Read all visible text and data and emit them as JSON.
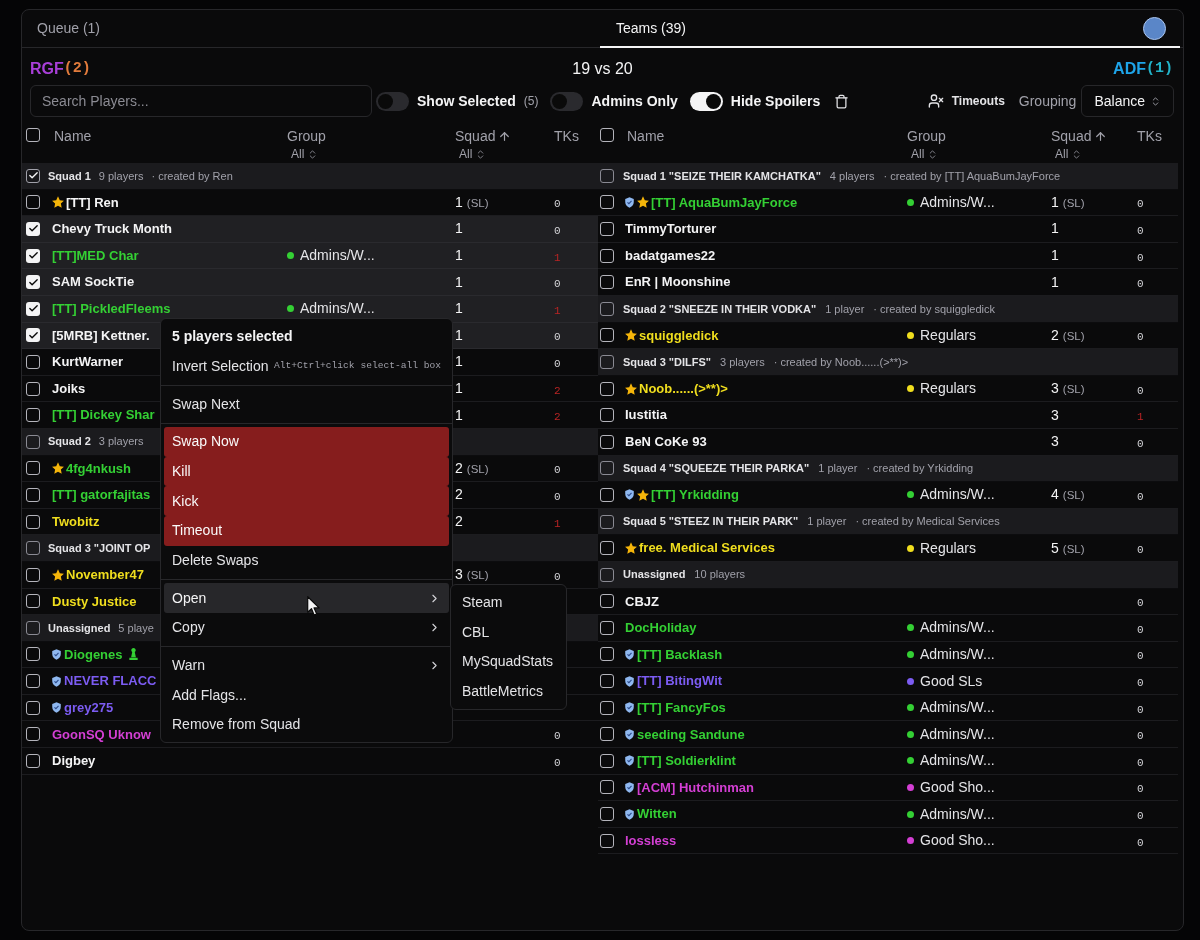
{
  "tabs": [
    {
      "label": "Queue (1)",
      "selected": false
    },
    {
      "label": "Teams (39)",
      "selected": true
    }
  ],
  "match": {
    "teams": [
      {
        "name": "RGF",
        "color": "#a83fd8",
        "count": {
          "label": "(2)",
          "color": "#e27b3c"
        }
      },
      {
        "name": "ADF",
        "color": "#1ea5ea",
        "count": {
          "label": "(1)",
          "color": "#22b3c9"
        }
      }
    ],
    "score": "19 vs 20"
  },
  "toolbar": {
    "search": {
      "placeholder": "Search Players..."
    },
    "toggles": [
      {
        "label": "Show Selected",
        "count": "(5)",
        "on": false
      },
      {
        "label": "Admins Only",
        "on": false
      },
      {
        "label": "Hide Spoilers",
        "on": true
      }
    ],
    "timeouts": "Timeouts",
    "grouping": {
      "label": "Grouping",
      "value": "Balance"
    }
  },
  "tables": [
    {
      "select_all": false,
      "columns": [
        {
          "label": "Name",
          "sorted": false
        },
        {
          "label": "Group",
          "filter": "All",
          "sorted": false
        },
        {
          "label": "Squad",
          "filter": "All",
          "sorted": true
        },
        {
          "label": "TKs",
          "sorted": false
        }
      ],
      "rows": [
        {
          "kind": "squad",
          "checked": true,
          "title": "Squad 1",
          "players": "9 players",
          "creator": "· created by Ren"
        },
        {
          "kind": "player",
          "checked": false,
          "name": "[TT] Ren",
          "color": "#f4f4f5",
          "shield": false,
          "star": true,
          "pawn": false,
          "squad": "1",
          "sl": "(SL)",
          "tks": "0",
          "tks_alert": false
        },
        {
          "kind": "player",
          "checked": true,
          "name": "Chevy Truck Month",
          "color": "#f4f4f5",
          "shield": false,
          "star": false,
          "pawn": false,
          "squad": "1",
          "tks": "0",
          "tks_alert": false
        },
        {
          "kind": "player",
          "checked": true,
          "name": "[TT]MED Char",
          "color": "#34d034",
          "shield": false,
          "star": false,
          "pawn": false,
          "group": {
            "label": "Admins/W...",
            "color": "#34d034"
          },
          "squad": "1",
          "tks": "1",
          "tks_alert": true
        },
        {
          "kind": "player",
          "checked": true,
          "name": "SAM SockTie",
          "color": "#f4f4f5",
          "shield": false,
          "star": false,
          "pawn": false,
          "squad": "1",
          "tks": "0",
          "tks_alert": false
        },
        {
          "kind": "player",
          "checked": true,
          "name": "[TT] PickledFleems",
          "color": "#34d034",
          "shield": false,
          "star": false,
          "pawn": false,
          "group": {
            "label": "Admins/W...",
            "color": "#34d034"
          },
          "squad": "1",
          "tks": "1",
          "tks_alert": true
        },
        {
          "kind": "player",
          "checked": true,
          "name": "[5MRB] Kettner.",
          "color": "#f4f4f5",
          "shield": false,
          "star": false,
          "pawn": false,
          "squad": "1",
          "tks": "0",
          "tks_alert": false
        },
        {
          "kind": "player",
          "checked": false,
          "name": "KurtWarner",
          "color": "#f4f4f5",
          "shield": false,
          "star": false,
          "pawn": false,
          "squad": "1",
          "tks": "0",
          "tks_alert": false
        },
        {
          "kind": "player",
          "checked": false,
          "name": "Joiks",
          "color": "#f4f4f5",
          "shield": false,
          "star": false,
          "pawn": false,
          "squad": "1",
          "tks": "2",
          "tks_alert": true
        },
        {
          "kind": "player",
          "checked": false,
          "name": "[TT] Dickey Shar",
          "color": "#34d034",
          "shield": false,
          "star": false,
          "pawn": false,
          "squad": "1",
          "tks": "2",
          "tks_alert": true
        },
        {
          "kind": "squad",
          "checked": false,
          "title": "Squad 2",
          "players": "3 players"
        },
        {
          "kind": "player",
          "checked": false,
          "name": "4fg4nkush",
          "color": "#34d034",
          "shield": false,
          "star": true,
          "pawn": false,
          "squad": "2",
          "sl": "(SL)",
          "tks": "0",
          "tks_alert": false
        },
        {
          "kind": "player",
          "checked": false,
          "name": "[TT] gatorfajitas",
          "color": "#34d034",
          "shield": false,
          "star": false,
          "pawn": false,
          "squad": "2",
          "tks": "0",
          "tks_alert": false
        },
        {
          "kind": "player",
          "checked": false,
          "name": "Twobitz",
          "color": "#f0de1e",
          "shield": false,
          "star": false,
          "pawn": false,
          "squad": "2",
          "tks": "1",
          "tks_alert": true
        },
        {
          "kind": "squad",
          "checked": false,
          "title": "Squad 3 \"JOINT OP"
        },
        {
          "kind": "player",
          "checked": false,
          "name": "November47",
          "color": "#f0de1e",
          "shield": false,
          "star": true,
          "pawn": false,
          "squad": "3",
          "sl": "(SL)",
          "tks": "0",
          "tks_alert": false
        },
        {
          "kind": "player",
          "checked": false,
          "name": "Dusty Justice",
          "color": "#f0de1e",
          "shield": false,
          "star": false,
          "pawn": false
        },
        {
          "kind": "squad",
          "checked": false,
          "title": "Unassigned",
          "players": "5 playe"
        },
        {
          "kind": "player",
          "checked": false,
          "name": "Diogenes",
          "color": "#34d034",
          "shield": true,
          "star": false,
          "pawn": true
        },
        {
          "kind": "player",
          "checked": false,
          "name": "NEVER FLACC",
          "color": "#7c5cf2",
          "shield": true,
          "star": false,
          "pawn": false
        },
        {
          "kind": "player",
          "checked": false,
          "name": "grey275",
          "color": "#7c5cf2",
          "shield": true,
          "star": false,
          "pawn": false
        },
        {
          "kind": "player",
          "checked": false,
          "name": "GoonSQ Uknow",
          "color": "#d43fd4",
          "shield": false,
          "star": false,
          "pawn": false,
          "tks": "0",
          "tks_alert": false
        },
        {
          "kind": "player",
          "checked": false,
          "name": "Digbey",
          "color": "#f4f4f5",
          "shield": false,
          "star": false,
          "pawn": false,
          "tks": "0",
          "tks_alert": false
        }
      ]
    },
    {
      "select_all": false,
      "columns": [
        {
          "label": "Name",
          "sorted": false
        },
        {
          "label": "Group",
          "filter": "All",
          "sorted": false
        },
        {
          "label": "Squad",
          "filter": "All",
          "sorted": true
        },
        {
          "label": "TKs",
          "sorted": false
        }
      ],
      "rows": [
        {
          "kind": "squad",
          "checked": false,
          "title": "Squad 1 \"SEIZE THEIR KAMCHATKA\"",
          "players": "4 players",
          "creator": "· created by [TT] AquaBumJayForce"
        },
        {
          "kind": "player",
          "checked": false,
          "name": "[TT] AquaBumJayForce",
          "color": "#34d034",
          "shield": true,
          "star": true,
          "pawn": false,
          "group": {
            "label": "Admins/W...",
            "color": "#34d034"
          },
          "squad": "1",
          "sl": "(SL)",
          "tks": "0",
          "tks_alert": false
        },
        {
          "kind": "player",
          "checked": false,
          "name": "TimmyTorturer",
          "color": "#f4f4f5",
          "shield": false,
          "star": false,
          "pawn": false,
          "squad": "1",
          "tks": "0",
          "tks_alert": false
        },
        {
          "kind": "player",
          "checked": false,
          "name": "badatgames22",
          "color": "#f4f4f5",
          "shield": false,
          "star": false,
          "pawn": false,
          "squad": "1",
          "tks": "0",
          "tks_alert": false
        },
        {
          "kind": "player",
          "checked": false,
          "name": "EnR | Moonshine",
          "color": "#f4f4f5",
          "shield": false,
          "star": false,
          "pawn": false,
          "squad": "1",
          "tks": "0",
          "tks_alert": false
        },
        {
          "kind": "squad",
          "checked": false,
          "title": "Squad 2 \"SNEEZE IN THEIR VODKA\"",
          "players": "1 player",
          "creator": "· created by squiggledick"
        },
        {
          "kind": "player",
          "checked": false,
          "name": "squiggledick",
          "color": "#f0de1e",
          "shield": false,
          "star": true,
          "pawn": false,
          "group": {
            "label": "Regulars",
            "color": "#f0de1e"
          },
          "squad": "2",
          "sl": "(SL)",
          "tks": "0",
          "tks_alert": false
        },
        {
          "kind": "squad",
          "checked": false,
          "title": "Squad 3 \"DILFS\"",
          "players": "3 players",
          "creator": "· created by Noob......(>**)>"
        },
        {
          "kind": "player",
          "checked": false,
          "name": "Noob......(>**)>",
          "color": "#f0de1e",
          "shield": false,
          "star": true,
          "pawn": false,
          "group": {
            "label": "Regulars",
            "color": "#f0de1e"
          },
          "squad": "3",
          "sl": "(SL)",
          "tks": "0",
          "tks_alert": false
        },
        {
          "kind": "player",
          "checked": false,
          "name": "Iustitia",
          "color": "#f4f4f5",
          "shield": false,
          "star": false,
          "pawn": false,
          "squad": "3",
          "tks": "1",
          "tks_alert": true
        },
        {
          "kind": "player",
          "checked": false,
          "name": "BeN CoKe 93",
          "color": "#f4f4f5",
          "shield": false,
          "star": false,
          "pawn": false,
          "squad": "3",
          "tks": "0",
          "tks_alert": false
        },
        {
          "kind": "squad",
          "checked": false,
          "title": "Squad 4 \"SQUEEZE THEIR PARKA\"",
          "players": "1 player",
          "creator": "· created by Yrkidding"
        },
        {
          "kind": "player",
          "checked": false,
          "name": "[TT] Yrkidding",
          "color": "#34d034",
          "shield": true,
          "star": true,
          "pawn": false,
          "group": {
            "label": "Admins/W...",
            "color": "#34d034"
          },
          "squad": "4",
          "sl": "(SL)",
          "tks": "0",
          "tks_alert": false
        },
        {
          "kind": "squad",
          "checked": false,
          "title": "Squad 5 \"STEEZ IN THEIR PARK\"",
          "players": "1 player",
          "creator": "· created by Medical Services"
        },
        {
          "kind": "player",
          "checked": false,
          "name": "free. Medical Services",
          "color": "#f0de1e",
          "shield": false,
          "star": true,
          "pawn": false,
          "group": {
            "label": "Regulars",
            "color": "#f0de1e"
          },
          "squad": "5",
          "sl": "(SL)",
          "tks": "0",
          "tks_alert": false
        },
        {
          "kind": "squad",
          "checked": false,
          "title": "Unassigned",
          "players": "10 players"
        },
        {
          "kind": "player",
          "checked": false,
          "name": "CBJZ",
          "color": "#f4f4f5",
          "shield": false,
          "star": false,
          "pawn": false,
          "tks": "0",
          "tks_alert": false
        },
        {
          "kind": "player",
          "checked": false,
          "name": "DocHoliday",
          "color": "#34d034",
          "shield": false,
          "star": false,
          "pawn": false,
          "group": {
            "label": "Admins/W...",
            "color": "#34d034"
          },
          "tks": "0",
          "tks_alert": false
        },
        {
          "kind": "player",
          "checked": false,
          "name": "[TT] Backlash",
          "color": "#34d034",
          "shield": true,
          "star": false,
          "pawn": false,
          "group": {
            "label": "Admins/W...",
            "color": "#34d034"
          },
          "tks": "0",
          "tks_alert": false
        },
        {
          "kind": "player",
          "checked": false,
          "name": "[TT] BitingWit",
          "color": "#7c5cf2",
          "shield": true,
          "star": false,
          "pawn": false,
          "group": {
            "label": "Good SLs",
            "color": "#7c5cf2"
          },
          "tks": "0",
          "tks_alert": false
        },
        {
          "kind": "player",
          "checked": false,
          "name": "[TT] FancyFos",
          "color": "#34d034",
          "shield": true,
          "star": false,
          "pawn": false,
          "group": {
            "label": "Admins/W...",
            "color": "#34d034"
          },
          "tks": "0",
          "tks_alert": false
        },
        {
          "kind": "player",
          "checked": false,
          "name": "seeding Sandune",
          "color": "#34d034",
          "shield": true,
          "star": false,
          "pawn": false,
          "group": {
            "label": "Admins/W...",
            "color": "#34d034"
          },
          "tks": "0",
          "tks_alert": false
        },
        {
          "kind": "player",
          "checked": false,
          "name": "[TT] Soldierklint",
          "color": "#34d034",
          "shield": true,
          "star": false,
          "pawn": false,
          "group": {
            "label": "Admins/W...",
            "color": "#34d034"
          },
          "tks": "0",
          "tks_alert": false
        },
        {
          "kind": "player",
          "checked": false,
          "name": "[ACM] Hutchinman",
          "color": "#d43fd4",
          "shield": true,
          "star": false,
          "pawn": false,
          "group": {
            "label": "Good Sho...",
            "color": "#d43fd4"
          },
          "tks": "0",
          "tks_alert": false
        },
        {
          "kind": "player",
          "checked": false,
          "name": "Witten",
          "color": "#34d034",
          "shield": true,
          "star": false,
          "pawn": false,
          "group": {
            "label": "Admins/W...",
            "color": "#34d034"
          },
          "tks": "0",
          "tks_alert": false
        },
        {
          "kind": "player",
          "checked": false,
          "name": "lossless",
          "color": "#d43fd4",
          "shield": false,
          "star": false,
          "pawn": false,
          "group": {
            "label": "Good Sho...",
            "color": "#d43fd4"
          },
          "tks": "0",
          "tks_alert": false
        }
      ]
    }
  ],
  "context_menu": {
    "items": [
      {
        "kind": "label",
        "label": "5 players selected"
      },
      {
        "kind": "item",
        "label": "Invert Selection",
        "shortcut": "Alt+Ctrl+click select-all box",
        "highlighted": false
      },
      {
        "kind": "separator"
      },
      {
        "kind": "item",
        "label": "Swap Next",
        "highlighted": false
      },
      {
        "kind": "separator"
      },
      {
        "kind": "danger",
        "label": "Swap Now",
        "highlighted": false
      },
      {
        "kind": "danger",
        "label": "Kill",
        "highlighted": false
      },
      {
        "kind": "danger",
        "label": "Kick",
        "highlighted": false
      },
      {
        "kind": "danger",
        "label": "Timeout",
        "highlighted": false
      },
      {
        "kind": "item",
        "label": "Delete Swaps",
        "highlighted": false
      },
      {
        "kind": "separator"
      },
      {
        "kind": "submenu",
        "label": "Open",
        "highlighted": true
      },
      {
        "kind": "submenu",
        "label": "Copy",
        "highlighted": false
      },
      {
        "kind": "separator"
      },
      {
        "kind": "submenu",
        "label": "Warn",
        "highlighted": false
      },
      {
        "kind": "item",
        "label": "Add Flags...",
        "highlighted": false
      },
      {
        "kind": "item",
        "label": "Remove from Squad",
        "highlighted": false
      }
    ],
    "submenu": [
      "Steam",
      "CBL",
      "MySquadStats",
      "BattleMetrics"
    ]
  }
}
